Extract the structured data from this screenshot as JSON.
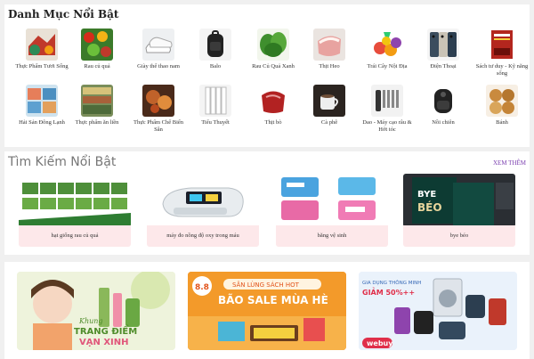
{
  "featured_categories": {
    "title": "Danh Mục Nổi Bật",
    "items": [
      {
        "label": "Thực Phẩm Tươi Sống",
        "icon": "fresh-food-icon"
      },
      {
        "label": "Rau củ quả",
        "icon": "vegetables-icon"
      },
      {
        "label": "Giày thể thao nam",
        "icon": "sneakers-icon"
      },
      {
        "label": "Balo",
        "icon": "backpack-icon"
      },
      {
        "label": "Rau Củ Quả Xanh",
        "icon": "greens-icon"
      },
      {
        "label": "Thịt Heo",
        "icon": "pork-icon"
      },
      {
        "label": "Trái Cây Nội Địa",
        "icon": "fruit-icon"
      },
      {
        "label": "Điện Thoại",
        "icon": "phone-icon"
      },
      {
        "label": "Sách tư duy - Kỹ năng sống",
        "icon": "book-icon"
      },
      {
        "label": "Hải Sản Đông Lạnh",
        "icon": "frozen-seafood-icon"
      },
      {
        "label": "Thực phẩm ăn liền",
        "icon": "instant-food-icon"
      },
      {
        "label": "Thực Phẩm Chế Biến Sẵn",
        "icon": "prepared-food-icon"
      },
      {
        "label": "Tiểu Thuyết",
        "icon": "novel-icon"
      },
      {
        "label": "Thịt bò",
        "icon": "beef-icon"
      },
      {
        "label": "Cà phê",
        "icon": "coffee-icon"
      },
      {
        "label": "Dao - Máy cạo râu & Hớt tóc",
        "icon": "shaver-icon"
      },
      {
        "label": "Nồi chiên",
        "icon": "air-fryer-icon"
      },
      {
        "label": "Bánh",
        "icon": "bakery-icon"
      }
    ]
  },
  "trending_search": {
    "title": "Tìm Kiếm Nổi Bật",
    "see_more": "XEM THÊM",
    "items": [
      {
        "label": "hạt giống rau củ quả",
        "icon": "seed-packets-icon"
      },
      {
        "label": "máy đo nồng độ oxy trong máu",
        "icon": "pulse-oximeter-icon"
      },
      {
        "label": "băng vệ sinh",
        "icon": "sanitary-pad-icon"
      },
      {
        "label": "bye béo",
        "icon": "diet-book-icon"
      }
    ]
  },
  "promo_banners": {
    "items": [
      {
        "name": "makeup-banner",
        "line1": "Khung",
        "line2": "TRANG ĐIỂM",
        "line3": "VẠN XINH"
      },
      {
        "name": "summer-book-sale-banner",
        "badge": "8.8",
        "line1": "SĂN LÙNG SÁCH HOT",
        "line2": "BÃO SALE MÙA HÈ"
      },
      {
        "name": "home-appliance-banner",
        "line1": "GIA DỤNG THÔNG MINH",
        "line2": "GIẢM 50%++",
        "brand": "webuy"
      }
    ]
  }
}
